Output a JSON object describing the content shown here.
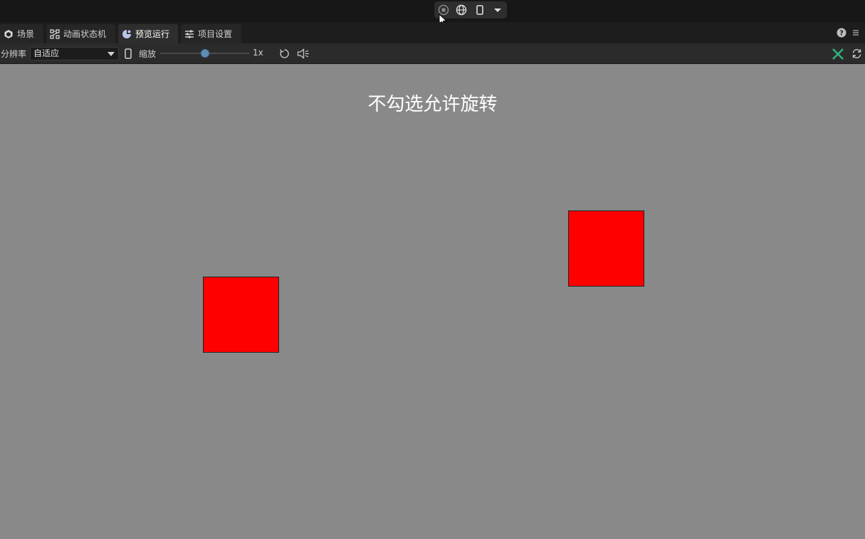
{
  "run_controls": {
    "items": [
      "stop-icon",
      "globe-icon",
      "phone-icon",
      "dropdown-caret-icon"
    ]
  },
  "tabs": [
    {
      "label": "场景",
      "icon": "scene-icon"
    },
    {
      "label": "动画状态机",
      "icon": "state-machine-icon"
    },
    {
      "label": "预览运行",
      "icon": "preview-icon",
      "active": true
    },
    {
      "label": "项目设置",
      "icon": "settings-icon"
    }
  ],
  "toolbar": {
    "resolution_label": "分辨率",
    "resolution_value": "自适应",
    "zoom_label": "缩放",
    "zoom_value_label": "1x",
    "zoom_level": 0.5
  },
  "viewport": {
    "title": "不勾选允许旋转",
    "background": "#898989",
    "box_color": "#ff0000"
  }
}
